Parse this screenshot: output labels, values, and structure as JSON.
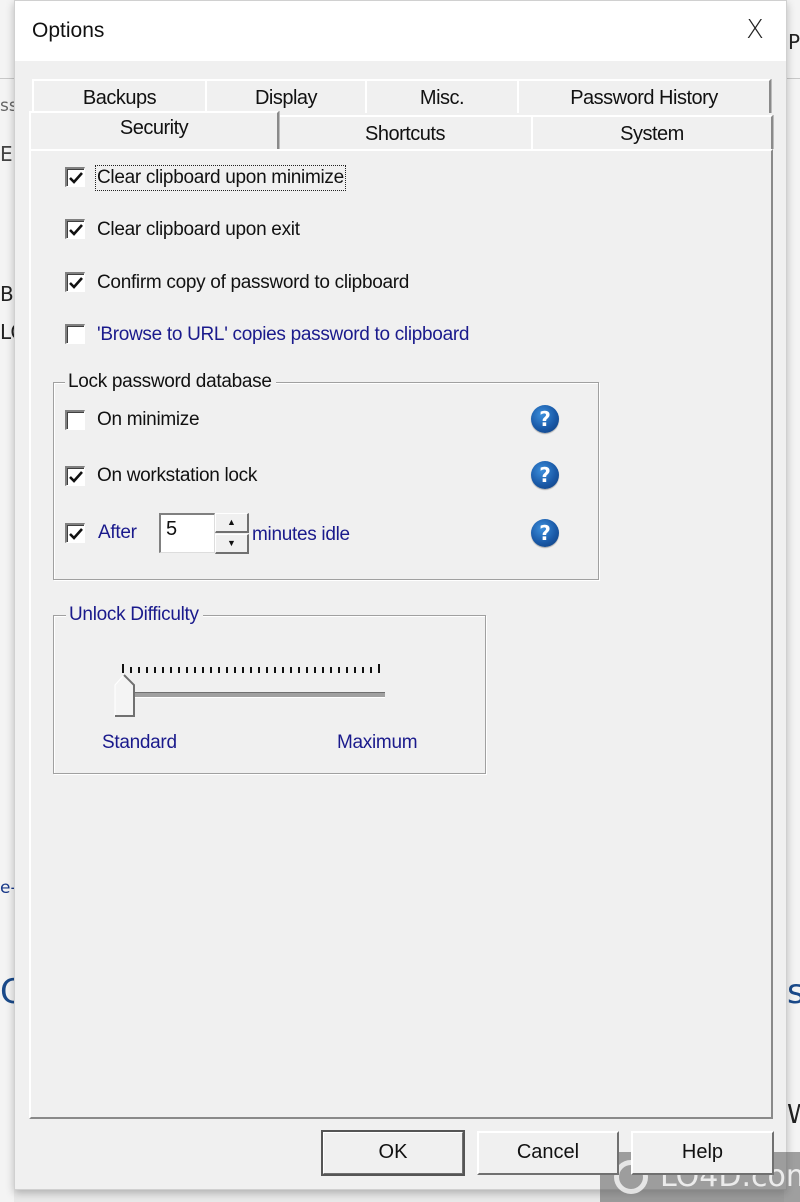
{
  "dialog": {
    "title": "Options",
    "close_label": "X"
  },
  "tabs": {
    "back_row": [
      {
        "label": "Backups"
      },
      {
        "label": "Display"
      },
      {
        "label": "Misc."
      },
      {
        "label": "Password History"
      }
    ],
    "front_row": [
      {
        "label": "Security",
        "active": true
      },
      {
        "label": "Shortcuts"
      },
      {
        "label": "System"
      }
    ]
  },
  "security": {
    "options": [
      {
        "label": "Clear clipboard upon minimize",
        "checked": true,
        "focused": true
      },
      {
        "label": "Clear clipboard upon exit",
        "checked": true
      },
      {
        "label": "Confirm copy of password to clipboard",
        "checked": true
      },
      {
        "label": "'Browse to URL' copies password to clipboard",
        "checked": false
      }
    ],
    "lock_group": {
      "title": "Lock password database",
      "on_minimize": {
        "label": "On minimize",
        "checked": false
      },
      "on_workstation_lock": {
        "label": "On workstation lock",
        "checked": true
      },
      "after_idle": {
        "label_before": "After",
        "value": "5",
        "label_after": "minutes idle",
        "checked": true
      },
      "help_glyph": "?"
    },
    "unlock_group": {
      "title": "Unlock Difficulty",
      "min_label": "Standard",
      "max_label": "Maximum",
      "slider_position": 0,
      "tick_count": 33
    }
  },
  "buttons": {
    "ok": "OK",
    "cancel": "Cancel",
    "help": "Help"
  },
  "spinner": {
    "up": "▲",
    "down": "▼"
  },
  "background": {
    "fragments": [
      "ss",
      "E",
      "Ba",
      "LO",
      "P",
      "e-(",
      "C",
      "s",
      "W"
    ]
  },
  "watermark": {
    "text": "LO4D.com"
  },
  "colors": {
    "label_blue": "#1a1a8c",
    "help_blue": "#1a5aa8",
    "dialog_bg": "#f0f0f0"
  }
}
